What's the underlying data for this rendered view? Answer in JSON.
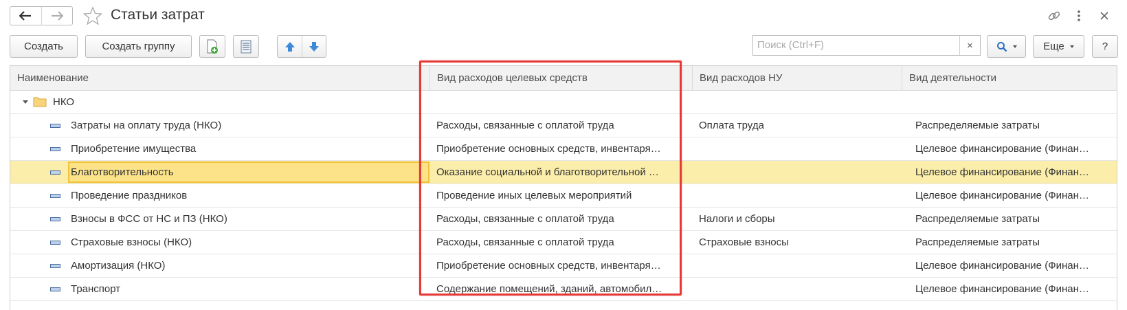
{
  "window": {
    "title": "Статьи затрат"
  },
  "toolbar": {
    "create_label": "Создать",
    "create_group_label": "Создать группу",
    "search_placeholder": "Поиск (Ctrl+F)",
    "search_clear": "×",
    "more_label": "Еще",
    "help_label": "?"
  },
  "table": {
    "columns": [
      "Наименование",
      "Вид расходов целевых средств",
      "Вид расходов НУ",
      "Вид деятельности"
    ],
    "group": {
      "name": "НКО"
    },
    "rows": [
      {
        "name": "Затраты на оплату труда (НКО)",
        "target_expense": "Расходы, связанные с оплатой труда",
        "tax_expense": "Оплата труда",
        "activity": "Распределяемые затраты"
      },
      {
        "name": "Приобретение имущества",
        "target_expense": "Приобретение основных средств, инвентаря…",
        "tax_expense": "",
        "activity": "Целевое финансирование (Финан…"
      },
      {
        "name": "Благотворительность",
        "target_expense": "Оказание социальной и благотворительной …",
        "tax_expense": "",
        "activity": "Целевое финансирование (Финан…"
      },
      {
        "name": "Проведение праздников",
        "target_expense": "Проведение иных целевых мероприятий",
        "tax_expense": "",
        "activity": "Целевое финансирование (Финан…"
      },
      {
        "name": "Взносы в ФСС от НС и ПЗ (НКО)",
        "target_expense": "Расходы, связанные с оплатой труда",
        "tax_expense": "Налоги и сборы",
        "activity": "Распределяемые затраты"
      },
      {
        "name": "Страховые взносы (НКО)",
        "target_expense": "Расходы, связанные с оплатой труда",
        "tax_expense": "Страховые взносы",
        "activity": "Распределяемые затраты"
      },
      {
        "name": "Амортизация (НКО)",
        "target_expense": "Приобретение основных средств, инвентаря…",
        "tax_expense": "",
        "activity": "Целевое финансирование (Финан…"
      },
      {
        "name": "Транспорт",
        "target_expense": "Содержание помещений, зданий, автомобил…",
        "tax_expense": "",
        "activity": "Целевое финансирование (Финан…"
      }
    ]
  },
  "colors": {
    "selected_row": "#fbedaa",
    "focus_cell": "#fce38a",
    "annotation": "#e53935"
  },
  "icons": [
    "back-arrow-icon",
    "forward-arrow-icon",
    "favorite-star-icon",
    "link-icon",
    "more-vertical-icon",
    "close-icon",
    "add-copy-icon",
    "list-icon",
    "move-up-icon",
    "move-down-icon",
    "search-icon",
    "folder-icon",
    "catalog-item-icon"
  ]
}
